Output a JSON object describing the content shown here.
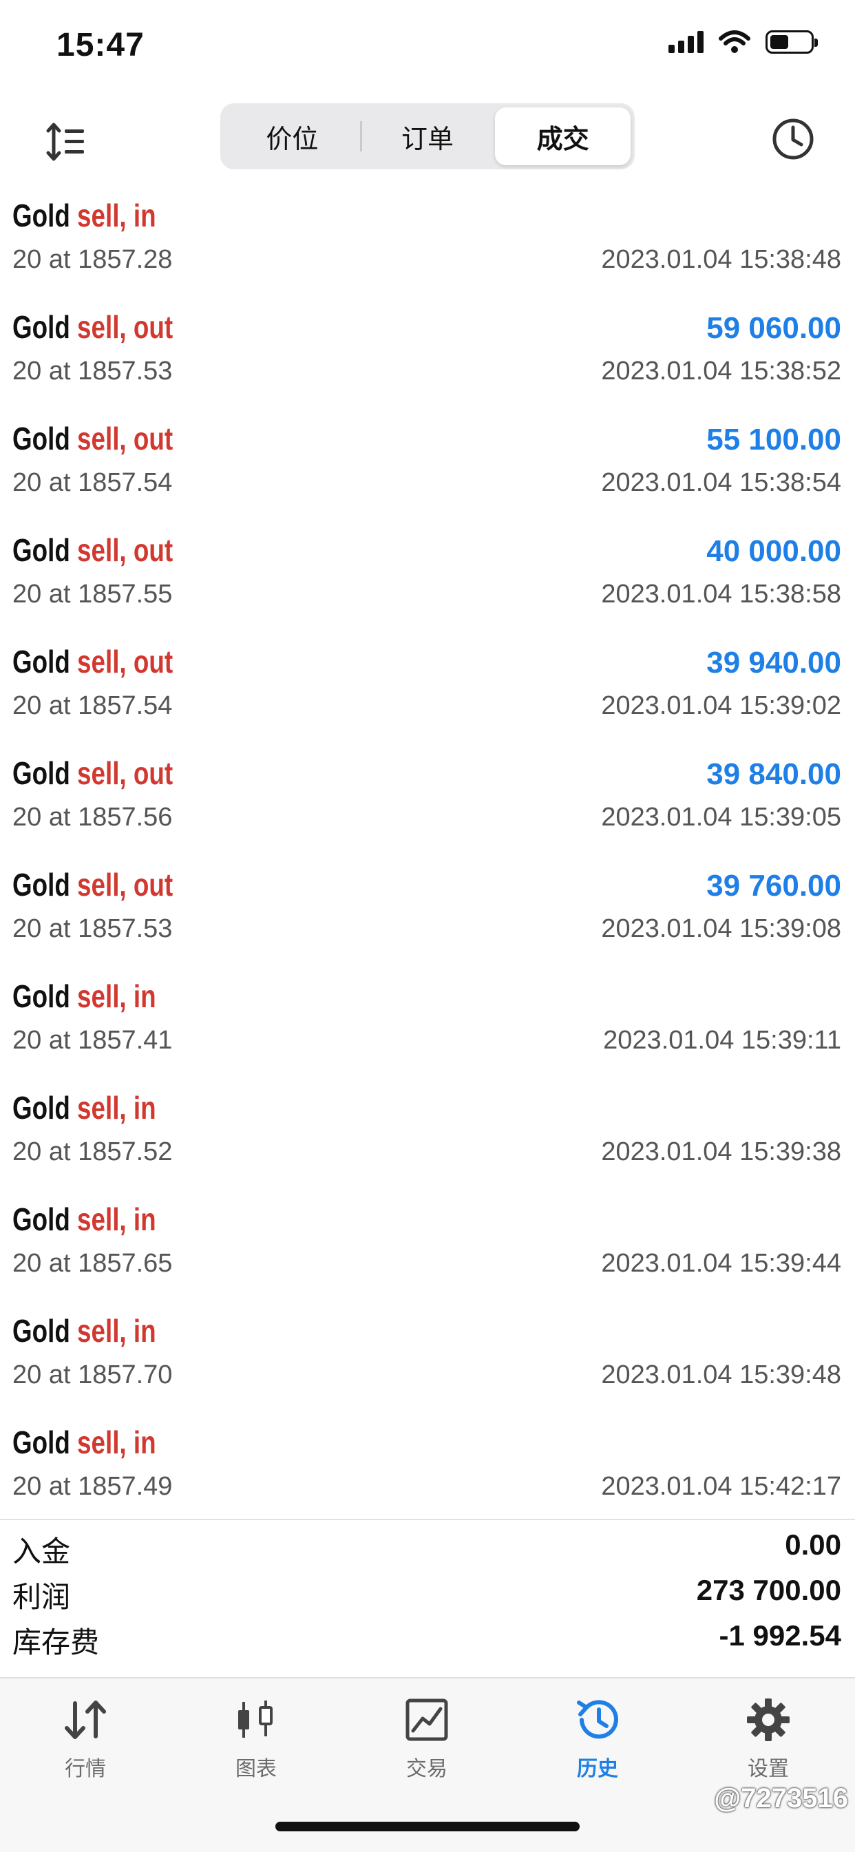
{
  "status_bar": {
    "time": "15:47"
  },
  "toolbar": {
    "tabs": [
      {
        "label": "价位",
        "active": false
      },
      {
        "label": "订单",
        "active": false
      },
      {
        "label": "成交",
        "active": true
      }
    ]
  },
  "deals": [
    {
      "symbol": "Gold",
      "direction": "sell, in",
      "profit": "",
      "volume_price": "20 at 1857.28",
      "time": "2023.01.04 15:38:48"
    },
    {
      "symbol": "Gold",
      "direction": "sell, out",
      "profit": "59 060.00",
      "volume_price": "20 at 1857.53",
      "time": "2023.01.04 15:38:52"
    },
    {
      "symbol": "Gold",
      "direction": "sell, out",
      "profit": "55 100.00",
      "volume_price": "20 at 1857.54",
      "time": "2023.01.04 15:38:54"
    },
    {
      "symbol": "Gold",
      "direction": "sell, out",
      "profit": "40 000.00",
      "volume_price": "20 at 1857.55",
      "time": "2023.01.04 15:38:58"
    },
    {
      "symbol": "Gold",
      "direction": "sell, out",
      "profit": "39 940.00",
      "volume_price": "20 at 1857.54",
      "time": "2023.01.04 15:39:02"
    },
    {
      "symbol": "Gold",
      "direction": "sell, out",
      "profit": "39 840.00",
      "volume_price": "20 at 1857.56",
      "time": "2023.01.04 15:39:05"
    },
    {
      "symbol": "Gold",
      "direction": "sell, out",
      "profit": "39 760.00",
      "volume_price": "20 at 1857.53",
      "time": "2023.01.04 15:39:08"
    },
    {
      "symbol": "Gold",
      "direction": "sell, in",
      "profit": "",
      "volume_price": "20 at 1857.41",
      "time": "2023.01.04 15:39:11"
    },
    {
      "symbol": "Gold",
      "direction": "sell, in",
      "profit": "",
      "volume_price": "20 at 1857.52",
      "time": "2023.01.04 15:39:38"
    },
    {
      "symbol": "Gold",
      "direction": "sell, in",
      "profit": "",
      "volume_price": "20 at 1857.65",
      "time": "2023.01.04 15:39:44"
    },
    {
      "symbol": "Gold",
      "direction": "sell, in",
      "profit": "",
      "volume_price": "20 at 1857.70",
      "time": "2023.01.04 15:39:48"
    },
    {
      "symbol": "Gold",
      "direction": "sell, in",
      "profit": "",
      "volume_price": "20 at 1857.49",
      "time": "2023.01.04 15:42:17"
    }
  ],
  "summary": [
    {
      "label": "入金",
      "value": "0.00"
    },
    {
      "label": "利润",
      "value": "273 700.00"
    },
    {
      "label": "库存费",
      "value": "-1 992.54"
    }
  ],
  "tabbar": {
    "items": [
      {
        "label": "行情",
        "icon": "quotes-icon",
        "active": false
      },
      {
        "label": "图表",
        "icon": "chart-icon",
        "active": false
      },
      {
        "label": "交易",
        "icon": "trade-icon",
        "active": false
      },
      {
        "label": "历史",
        "icon": "history-icon",
        "active": true
      },
      {
        "label": "设置",
        "icon": "settings-icon",
        "active": false
      }
    ]
  },
  "watermark": "@7273516",
  "colors": {
    "sell": "#d1382f",
    "profit": "#1e7fe6",
    "active_tab": "#1e7fe6"
  }
}
